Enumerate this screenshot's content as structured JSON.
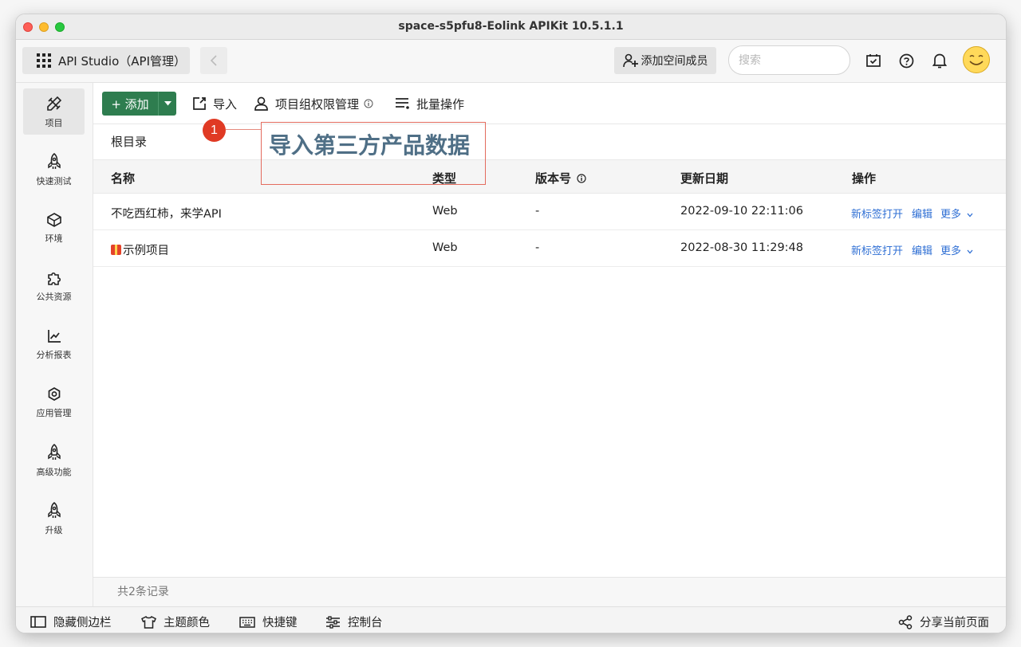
{
  "window": {
    "title": "space-s5pfu8-Eolink APIKit 10.5.1.1"
  },
  "topbar": {
    "app_switcher": "API Studio（API管理）",
    "add_member": "添加空间成员",
    "search_placeholder": "搜索"
  },
  "sidebar": {
    "items": [
      {
        "label": "项目",
        "icon": "pencil-ruler-icon",
        "active": true
      },
      {
        "label": "快速测试",
        "icon": "rocket-icon"
      },
      {
        "label": "环境",
        "icon": "cube-icon"
      },
      {
        "label": "公共资源",
        "icon": "puzzle-icon"
      },
      {
        "label": "分析报表",
        "icon": "line-chart-icon"
      },
      {
        "label": "应用管理",
        "icon": "gear-icon"
      },
      {
        "label": "高级功能",
        "icon": "rocket-icon"
      },
      {
        "label": "升级",
        "icon": "rocket-icon"
      }
    ]
  },
  "toolbar": {
    "add": "+ 添加",
    "import": "导入",
    "permissions": "项目组权限管理",
    "batch": "批量操作"
  },
  "breadcrumb": "根目录",
  "table": {
    "columns": [
      "名称",
      "类型",
      "版本号",
      "更新日期",
      "操作"
    ],
    "rows": [
      {
        "name": "不吃西红柿，来学API",
        "type": "Web",
        "version": "-",
        "updated": "2022-09-10 22:11:06"
      },
      {
        "name": "示例项目",
        "type": "Web",
        "version": "-",
        "updated": "2022-08-30 11:29:48"
      }
    ],
    "actions": {
      "open_tab": "新标签打开",
      "edit": "编辑",
      "more": "更多"
    },
    "footer": "共2条记录"
  },
  "statusbar": {
    "hide_sidebar": "隐藏侧边栏",
    "theme": "主题颜色",
    "shortcuts": "快捷键",
    "console": "控制台",
    "share": "分享当前页面"
  },
  "callout": {
    "number": "1",
    "text": "导入第三方产品数据"
  },
  "colors": {
    "primary_green": "#2e7d4f",
    "link_blue": "#2f6fd4",
    "callout_red": "#e03a24"
  }
}
